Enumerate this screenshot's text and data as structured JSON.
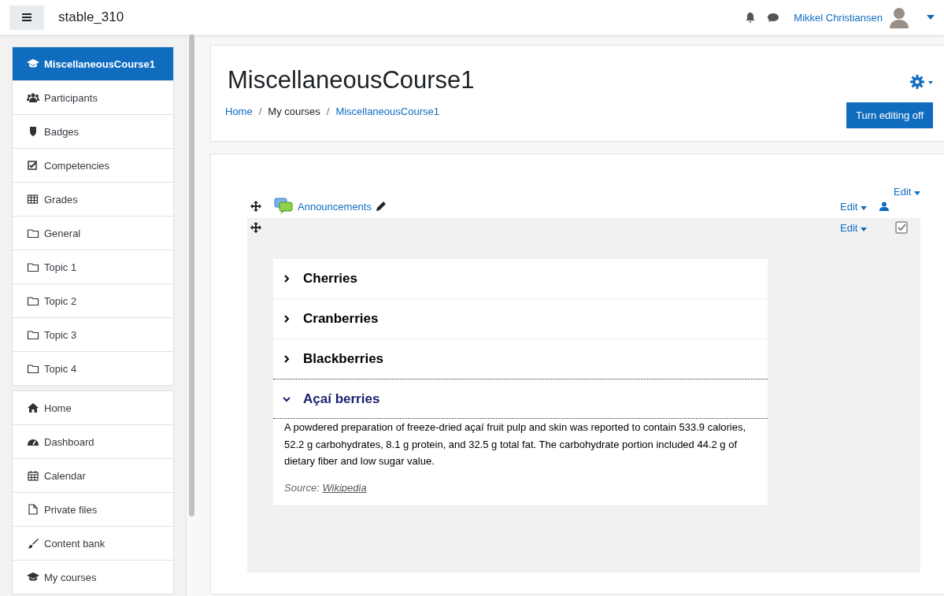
{
  "header": {
    "site_name": "stable_310",
    "user_name": "Mikkel Christiansen"
  },
  "sidebar": {
    "groups": [
      {
        "items": [
          {
            "label": "MiscellaneousCourse1",
            "kind": "cap",
            "selected": true
          },
          {
            "label": "Participants",
            "kind": "users",
            "selected": false
          },
          {
            "label": "Badges",
            "kind": "shield",
            "selected": false
          },
          {
            "label": "Competencies",
            "kind": "check",
            "selected": false
          },
          {
            "label": "Grades",
            "kind": "table",
            "selected": false
          },
          {
            "label": "General",
            "kind": "folder",
            "selected": false
          },
          {
            "label": "Topic 1",
            "kind": "folder",
            "selected": false
          },
          {
            "label": "Topic 2",
            "kind": "folder",
            "selected": false
          },
          {
            "label": "Topic 3",
            "kind": "folder",
            "selected": false
          },
          {
            "label": "Topic 4",
            "kind": "folder",
            "selected": false
          }
        ]
      },
      {
        "items": [
          {
            "label": "Home",
            "kind": "home",
            "selected": false
          },
          {
            "label": "Dashboard",
            "kind": "gauge",
            "selected": false
          },
          {
            "label": "Calendar",
            "kind": "calendar",
            "selected": false
          },
          {
            "label": "Private files",
            "kind": "file",
            "selected": false
          },
          {
            "label": "Content bank",
            "kind": "brush",
            "selected": false
          },
          {
            "label": "My courses",
            "kind": "cap",
            "selected": false
          }
        ]
      }
    ]
  },
  "page": {
    "title": "MiscellaneousCourse1",
    "breadcrumb": [
      {
        "label": "Home",
        "link": true
      },
      {
        "separator": "/",
        "label": "My courses",
        "link": false
      },
      {
        "separator": "/",
        "label": "MiscellaneousCourse1",
        "link": true
      }
    ],
    "editing_button": "Turn editing off"
  },
  "section": {
    "edit_label": "Edit",
    "activities": [
      {
        "kind": "forum",
        "name": "Announcements",
        "edit_label": "Edit"
      },
      {
        "kind": "label",
        "edit_label": "Edit"
      }
    ]
  },
  "accordion": [
    {
      "title": "Cherries",
      "expanded": false
    },
    {
      "title": "Cranberries",
      "expanded": false
    },
    {
      "title": "Blackberries",
      "expanded": false
    },
    {
      "title": "Açaí berries",
      "expanded": true,
      "body": "A powdered preparation of freeze-dried açaí fruit pulp and skin was reported to contain 533.9 calories, 52.2 g carbohydrates, 8.1 g protein, and 32.5 g total fat. The carbohydrate portion included 44.2 g of dietary fiber and low sugar value.",
      "source_label": "Source:",
      "source_link": "Wikipedia"
    }
  ]
}
